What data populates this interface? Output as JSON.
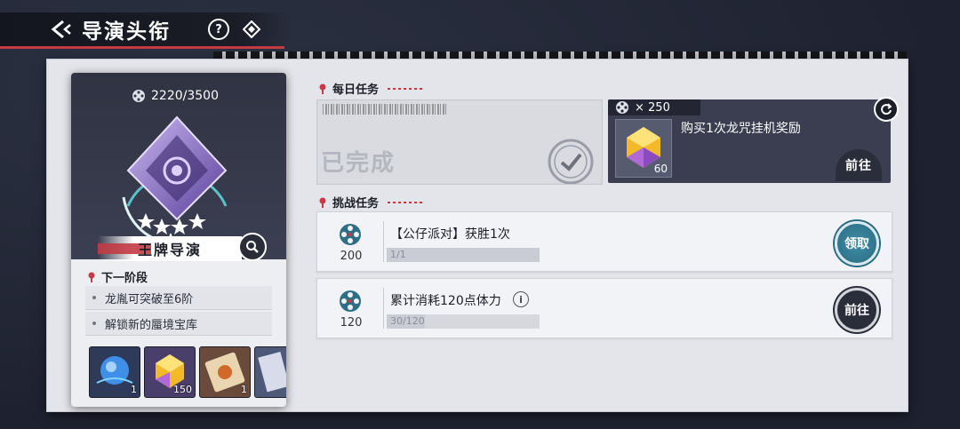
{
  "header": {
    "title": "导演头衔",
    "help_label": "?"
  },
  "profile": {
    "progress_text": "2220/3500",
    "progress_value": 2220,
    "progress_max": 3500,
    "rank_title": "王牌导演",
    "next_stage_title": "下一阶段",
    "next_stage_items": [
      "龙胤可突破至6阶",
      "解锁新的蜃境宝库"
    ],
    "rewards": [
      {
        "icon": "blue-orb-icon",
        "count": "1"
      },
      {
        "icon": "crystal-icon",
        "count": "150"
      },
      {
        "icon": "ticket-icon",
        "count": "1"
      },
      {
        "icon": "card-icon",
        "count": ""
      }
    ]
  },
  "daily": {
    "section_title": "每日任务",
    "completed_text": "已完成",
    "reward_card": {
      "cost": "× 250",
      "description": "购买1次龙咒挂机奖励",
      "item_count": "60",
      "button_label": "前往"
    }
  },
  "challenge": {
    "section_title": "挑战任务",
    "tasks": [
      {
        "points": "200",
        "name": "【公仔派对】获胜1次",
        "progress": "1/1",
        "ratio": 1.0,
        "button_label": "领取",
        "state": "claim"
      },
      {
        "points": "120",
        "name": "累计消耗120点体力",
        "progress": "30/120",
        "ratio": 0.25,
        "button_label": "前往",
        "state": "go"
      }
    ]
  },
  "colors": {
    "accent_red": "#c23b45",
    "claim_teal": "#2a6b82",
    "dark_panel": "#3a3e50"
  }
}
